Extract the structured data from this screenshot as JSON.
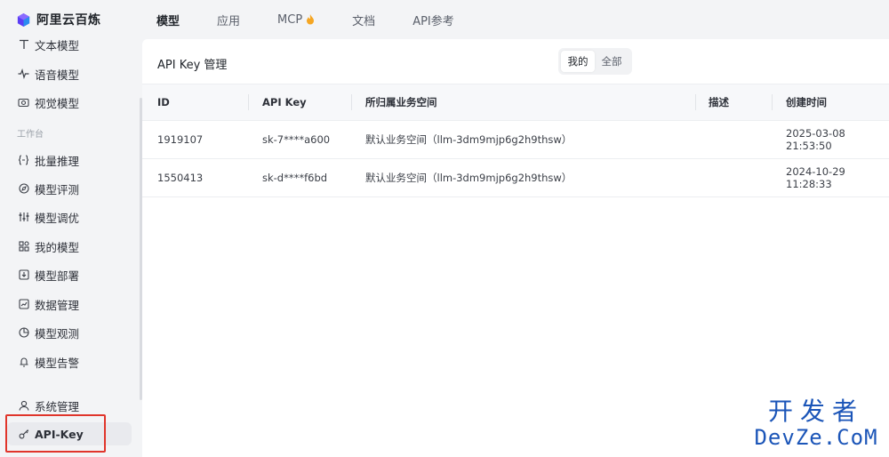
{
  "brand": {
    "name": "阿里云百炼"
  },
  "topnav": [
    {
      "label": "模型",
      "active": true
    },
    {
      "label": "应用",
      "active": false
    },
    {
      "label": "MCP",
      "active": false,
      "icon": "flame-icon"
    },
    {
      "label": "文档",
      "active": false
    },
    {
      "label": "API参考",
      "active": false
    }
  ],
  "sidebar": {
    "items_top": [
      {
        "label": "文本模型",
        "icon": "text-icon"
      },
      {
        "label": "语音模型",
        "icon": "audio-wave-icon"
      },
      {
        "label": "视觉模型",
        "icon": "camera-icon"
      }
    ],
    "section_label": "工作台",
    "items_work": [
      {
        "label": "批量推理",
        "icon": "braces-icon"
      },
      {
        "label": "模型评测",
        "icon": "compass-icon"
      },
      {
        "label": "模型调优",
        "icon": "sliders-icon"
      },
      {
        "label": "我的模型",
        "icon": "grid-icon"
      },
      {
        "label": "模型部署",
        "icon": "deploy-icon"
      },
      {
        "label": "数据管理",
        "icon": "chart-icon"
      },
      {
        "label": "模型观测",
        "icon": "pie-icon"
      },
      {
        "label": "模型告警",
        "icon": "alarm-icon"
      }
    ],
    "items_bottom": [
      {
        "label": "系统管理",
        "icon": "user-icon"
      },
      {
        "label": "API-Key",
        "icon": "key-icon",
        "active": true
      }
    ]
  },
  "panel": {
    "title": "API Key 管理",
    "segments": [
      {
        "label": "我的",
        "active": true
      },
      {
        "label": "全部",
        "active": false
      }
    ]
  },
  "table": {
    "columns": [
      "ID",
      "API Key",
      "所归属业务空间",
      "描述",
      "创建时间"
    ],
    "rows": [
      {
        "id": "1919107",
        "key": "sk-7****a600",
        "space": "默认业务空间（llm-3dm9mjp6g2h9thsw）",
        "desc": "",
        "created": "2025-03-08 21:53:50"
      },
      {
        "id": "1550413",
        "key": "sk-d****f6bd",
        "space": "默认业务空间（llm-3dm9mjp6g2h9thsw）",
        "desc": "",
        "created": "2024-10-29 11:28:33"
      }
    ]
  },
  "watermark": {
    "line1": "开发者",
    "line2": "DevZe.CoM"
  },
  "colors": {
    "highlight": "#e0352b",
    "watermark": "#1b55b8",
    "flame": "#f5a623"
  }
}
